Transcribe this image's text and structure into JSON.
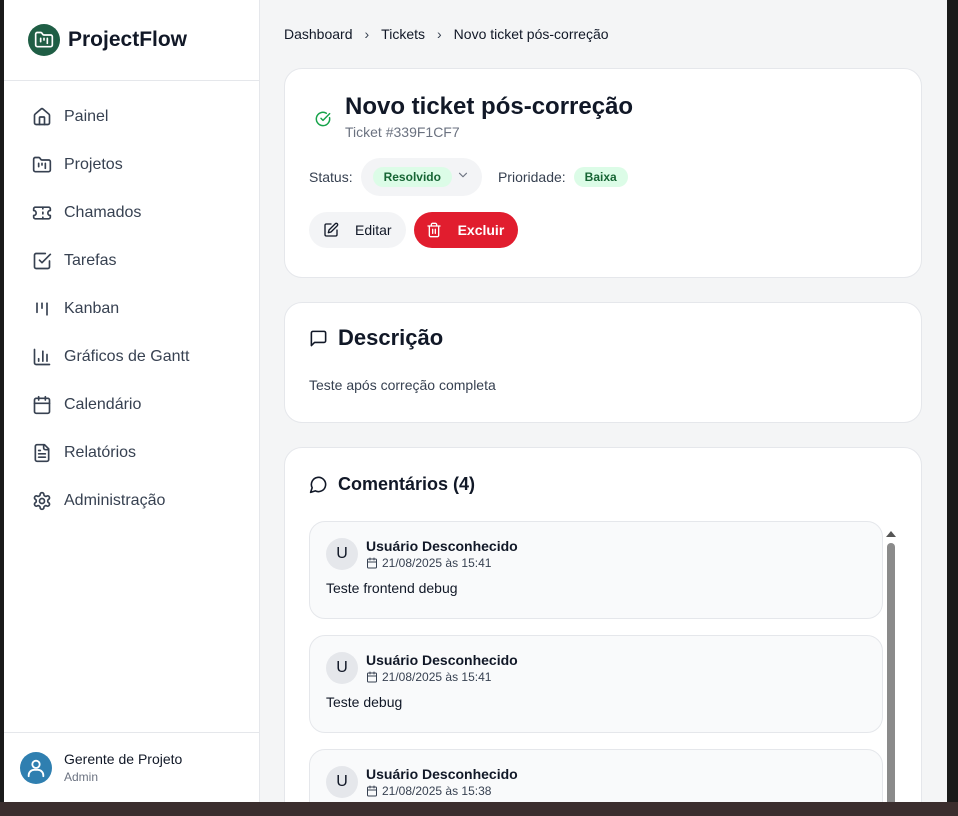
{
  "app": {
    "name": "ProjectFlow"
  },
  "sidebar": {
    "items": [
      {
        "label": "Painel",
        "icon": "home-icon"
      },
      {
        "label": "Projetos",
        "icon": "folder-kanban-icon"
      },
      {
        "label": "Chamados",
        "icon": "ticket-icon"
      },
      {
        "label": "Tarefas",
        "icon": "checkbox-icon"
      },
      {
        "label": "Kanban",
        "icon": "kanban-icon"
      },
      {
        "label": "Gráficos de Gantt",
        "icon": "bar-chart-icon"
      },
      {
        "label": "Calendário",
        "icon": "calendar-icon"
      },
      {
        "label": "Relatórios",
        "icon": "file-text-icon"
      },
      {
        "label": "Administração",
        "icon": "gear-icon"
      }
    ],
    "user": {
      "name": "Gerente de Projeto",
      "role": "Admin"
    }
  },
  "breadcrumb": {
    "items": [
      "Dashboard",
      "Tickets",
      "Novo ticket pós-correção"
    ]
  },
  "ticket": {
    "title": "Novo ticket pós-correção",
    "id": "Ticket #339F1CF7",
    "status_label": "Status:",
    "status_value": "Resolvido",
    "priority_label": "Prioridade:",
    "priority_value": "Baixa",
    "edit_label": "Editar",
    "delete_label": "Excluir"
  },
  "description": {
    "title": "Descrição",
    "text": "Teste após correção completa"
  },
  "comments": {
    "title": "Comentários (4)",
    "items": [
      {
        "avatar": "U",
        "author": "Usuário Desconhecido",
        "date": "21/08/2025 às 15:41",
        "body": "Teste frontend debug"
      },
      {
        "avatar": "U",
        "author": "Usuário Desconhecido",
        "date": "21/08/2025 às 15:41",
        "body": "Teste debug"
      },
      {
        "avatar": "U",
        "author": "Usuário Desconhecido",
        "date": "21/08/2025 às 15:38",
        "body": ""
      }
    ]
  },
  "colors": {
    "brand": "#1f5e45",
    "danger": "#e11d2e",
    "success_bg": "#dcfce7",
    "success_text": "#166534"
  }
}
